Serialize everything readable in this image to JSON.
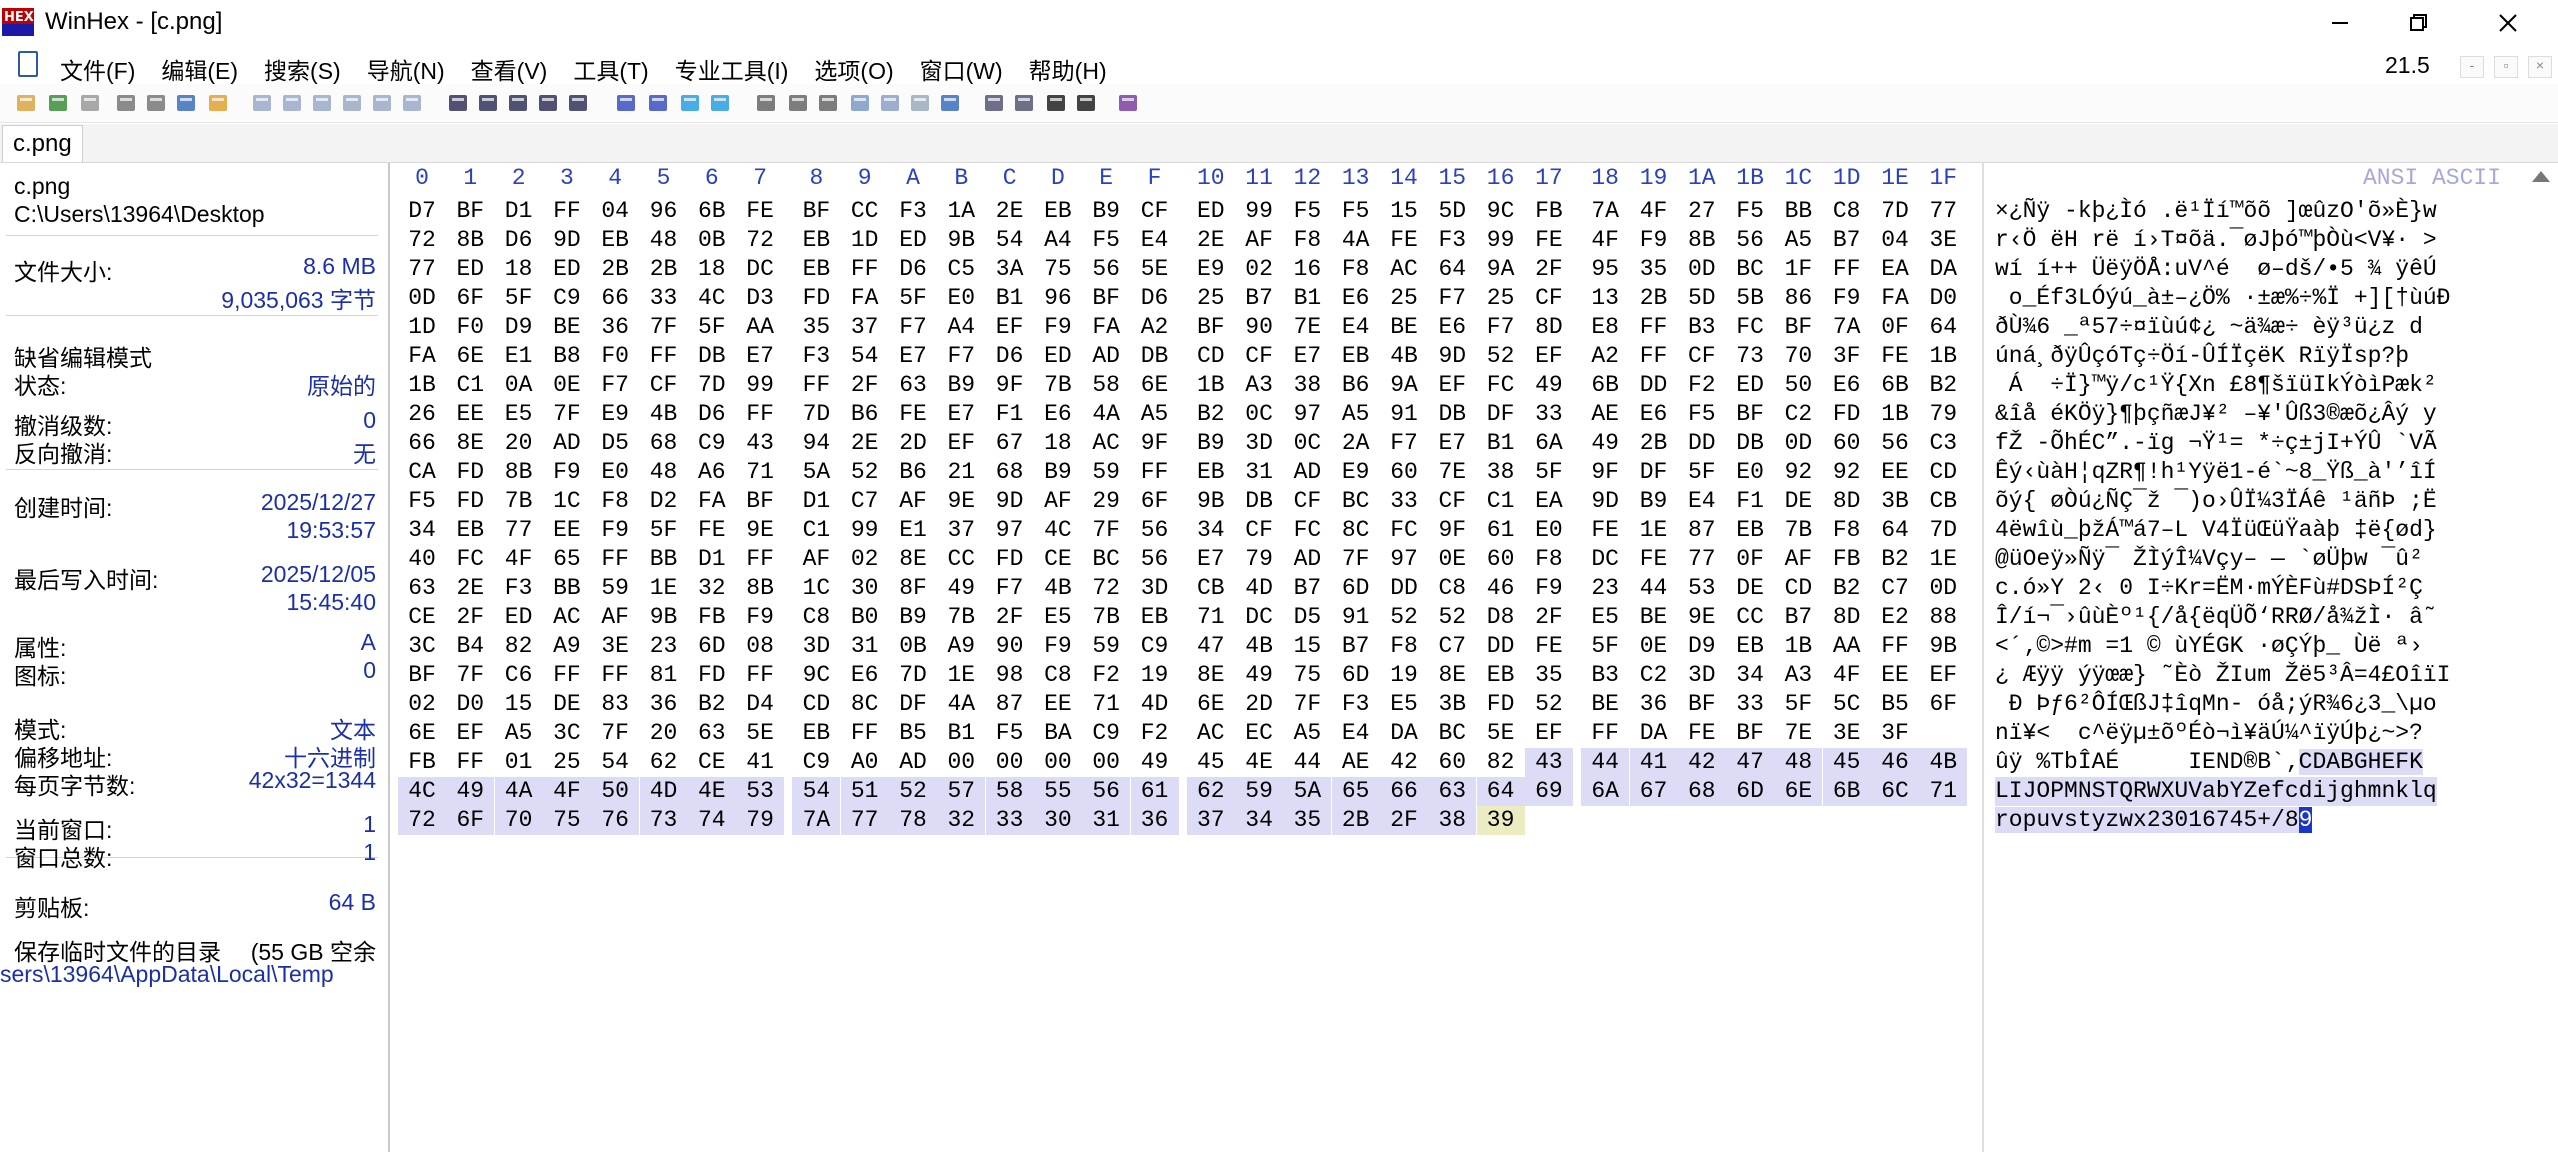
{
  "window": {
    "title": "WinHex - [c.png]",
    "logo_text": "HEX"
  },
  "menu": {
    "items": [
      "文件(F)",
      "编辑(E)",
      "搜索(S)",
      "导航(N)",
      "查看(V)",
      "工具(T)",
      "专业工具(I)",
      "选项(O)",
      "窗口(W)",
      "帮助(H)"
    ],
    "zoom": "21.5"
  },
  "toolbar": {
    "icons": [
      "new-file-icon",
      "open-file-icon",
      "save-icon",
      "print-icon",
      "printer-icon",
      "properties-icon",
      "open-folder-icon",
      "undo-icon",
      "copy-icon",
      "cut-icon",
      "paste-icon",
      "paste-write-icon",
      "paste-special-icon",
      "find-icon",
      "find-hex-icon",
      "find-text-icon",
      "replace-icon",
      "replace-hex-icon",
      "goto-offset-icon",
      "goto-end-icon",
      "back-arrow-icon",
      "forward-arrow-icon",
      "disk-icon",
      "open-disk-icon",
      "ram-icon",
      "calculator-icon",
      "magnifier-icon",
      "hashes-icon",
      "options-gear-icon",
      "position-icon",
      "columns-icon",
      "prev-icon",
      "next-icon",
      "help-book-icon"
    ]
  },
  "tab": {
    "label": "c.png"
  },
  "info": {
    "file_name": "c.png",
    "file_path": "C:\\Users\\13964\\Desktop",
    "size_label": "文件大小:",
    "size_mb": "8.6 MB",
    "size_bytes": "9,035,063 字节",
    "edit_mode_label": "缺省编辑模式",
    "state_label": "状态:",
    "state_value": "原始的",
    "undo_level_label": "撤消级数:",
    "undo_level_value": "0",
    "reverse_undo_label": "反向撤消:",
    "reverse_undo_value": "无",
    "created_label": "创建时间:",
    "created_date": "2025/12/27",
    "created_time": "19:53:57",
    "modified_label": "最后写入时间:",
    "modified_date": "2025/12/05",
    "modified_time": "15:45:40",
    "attr_label": "属性:",
    "attr_value": "A",
    "icon_label": "图标:",
    "icon_value": "0",
    "mode_label": "模式:",
    "mode_value": "文本",
    "offset_label": "偏移地址:",
    "offset_value": "十六进制",
    "bpp_label": "每页字节数:",
    "bpp_value": "42x32=1344",
    "curwin_label": "当前窗口:",
    "curwin_value": "1",
    "totwin_label": "窗口总数:",
    "totwin_value": "1",
    "clip_label": "剪贴板:",
    "clip_value": "64 B",
    "temp_label": "保存临时文件的目录",
    "temp_free": "(55 GB 空余",
    "temp_path": "sers\\13964\\AppData\\Local\\Temp"
  },
  "hex": {
    "header": [
      "0",
      "1",
      "2",
      "3",
      "4",
      "5",
      "6",
      "7",
      "8",
      "9",
      "A",
      "B",
      "C",
      "D",
      "E",
      "F",
      "10",
      "11",
      "12",
      "13",
      "14",
      "15",
      "16",
      "17",
      "18",
      "19",
      "1A",
      "1B",
      "1C",
      "1D",
      "1E",
      "1F"
    ],
    "rows": [
      "D7 BF D1 FF 04 96 6B FE BF CC F3 1A 2E EB B9 CF ED 99 F5 F5 15 5D 9C FB 7A 4F 27 F5 BB C8 7D 77",
      "72 8B D6 9D EB 48 0B 72 EB 1D ED 9B 54 A4 F5 E4 2E AF F8 4A FE F3 99 FE 4F F9 8B 56 A5 B7 04 3E",
      "77 ED 18 ED 2B 2B 18 DC EB FF D6 C5 3A 75 56 5E E9 02 16 F8 AC 64 9A 2F 95 35 0D BC 1F FF EA DA",
      "0D 6F 5F C9 66 33 4C D3 FD FA 5F E0 B1 96 BF D6 25 B7 B1 E6 25 F7 25 CF 13 2B 5D 5B 86 F9 FA D0",
      "1D F0 D9 BE 36 7F 5F AA 35 37 F7 A4 EF F9 FA A2 BF 90 7E E4 BE E6 F7 8D E8 FF B3 FC BF 7A 0F 64",
      "FA 6E E1 B8 F0 FF DB E7 F3 54 E7 F7 D6 ED AD DB CD CF E7 EB 4B 9D 52 EF A2 FF CF 73 70 3F FE 1B",
      "1B C1 0A 0E F7 CF 7D 99 FF 2F 63 B9 9F 7B 58 6E 1B A3 38 B6 9A EF FC 49 6B DD F2 ED 50 E6 6B B2",
      "26 EE E5 7F E9 4B D6 FF 7D B6 FE E7 F1 E6 4A A5 B2 0C 97 A5 91 DB DF 33 AE E6 F5 BF C2 FD 1B 79",
      "66 8E 20 AD D5 68 C9 43 94 2E 2D EF 67 18 AC 9F B9 3D 0C 2A F7 E7 B1 6A 49 2B DD DB 0D 60 56 C3",
      "CA FD 8B F9 E0 48 A6 71 5A 52 B6 21 68 B9 59 FF EB 31 AD E9 60 7E 38 5F 9F DF 5F E0 92 92 EE CD",
      "F5 FD 7B 1C F8 D2 FA BF D1 C7 AF 9E 9D AF 29 6F 9B DB CF BC 33 CF C1 EA 9D B9 E4 F1 DE 8D 3B CB",
      "34 EB 77 EE F9 5F FE 9E C1 99 E1 37 97 4C 7F 56 34 CF FC 8C FC 9F 61 E0 FE 1E 87 EB 7B F8 64 7D",
      "40 FC 4F 65 FF BB D1 FF AF 02 8E CC FD CE BC 56 E7 79 AD 7F 97 0E 60 F8 DC FE 77 0F AF FB B2 1E",
      "63 2E F3 BB 59 1E 32 8B 1C 30 8F 49 F7 4B 72 3D CB 4D B7 6D DD C8 46 F9 23 44 53 DE CD B2 C7 0D",
      "CE 2F ED AC AF 9B FB F9 C8 B0 B9 7B 2F E5 7B EB 71 DC D5 91 52 52 D8 2F E5 BE 9E CC B7 8D E2 88",
      "3C B4 82 A9 3E 23 6D 08 3D 31 0B A9 90 F9 59 C9 47 4B 15 B7 F8 C7 DD FE 5F 0E D9 EB 1B AA FF 9B",
      "BF 7F C6 FF FF 81 FD FF 9C E6 7D 1E 98 C8 F2 19 8E 49 75 6D 19 8E EB 35 B3 C2 3D 34 A3 4F EE EF",
      "02 D0 15 DE 83 36 B2 D4 CD 8C DF 4A 87 EE 71 4D 6E 2D 7F F3 E5 3B FD 52 BE 36 BF 33 5F 5C B5 6F",
      "6E EF A5 3C 7F 20 63 5E EB FF B5 B1 F5 BA C9 F2 AC EC A5 E4 DA BC 5E EF FF DA FE BF 7E 3E 3F",
      "FB FF 01 25 54 62 CE 41 C9 A0 AD 00 00 00 00 49 45 4E 44 AE 42 60 82 43 44 41 42 47 48 45 46 4B",
      "4C 49 4A 4F 50 4D 4E 53 54 51 52 57 58 55 56 61 62 59 5A 65 66 63 64 69 6A 67 68 6D 6E 6B 6C 71",
      "72 6F 70 75 76 73 74 79 7A 77 78 32 33 30 31 36 37 34 35 2B 2F 38 39"
    ]
  },
  "text": {
    "header": "ANSI ASCII",
    "rows": [
      "×¿Ñÿ -kþ¿Ìó .ë¹Ïí™õõ ]œûzO'õ»È}w",
      "r‹Ö ëH rë í›T¤õä.¯øJþó™þÒù<V¥· >",
      "wí í++ ÜëÿÖÅ:uV^é  ø–dš/•5 ¾ ÿêÚ",
      " o_Éf3LÓýú_à±–¿Ö% ·±æ%÷%Ï +][†ùúÐ",
      "ðÙ¾6 _ª57÷¤ïùú¢¿ ~ä¾æ÷ èÿ³ü¿z d",
      "úná¸ðÿÛçóTç÷Öí-ÛÍÏçëK RïÿÏsp?þ",
      " Á  ÷Ï}™ÿ/c¹Ÿ{Xn £8¶šïüIkÝòìPæk²",
      "&îå éKÖÿ}¶þçñæJ¥² –¥'Ûß3®æõ¿Âý y",
      "fŽ -ÕhÉC”.-ïg ¬Ÿ¹= *÷ç±jI+ÝÛ `VÃ",
      "Êý‹ùàH¦qZR¶!h¹Yÿë1-é`~8_Ÿß_à'’îÍ",
      "õý{ øÒú¿ÑÇ¯ž ¯)o›ÛÏ¼3ÏÁê ¹äñÞ ;Ë",
      "4ëwîù_þžÁ™á7–L V4ÏüŒüŸaàþ ‡ë{ød}",
      "@üOeÿ»Ñÿ¯ ŽÌýÎ¼Vçy– — `øÜþw ¯û²",
      "c.ó»Y 2‹ 0 I÷Kr=ËM·mÝÈFù#DSÞÍ²Ç",
      "Î/í¬¯›ûùÈº¹{/å{ëqÜÕ‘RRØ/å¾žÌ· â˜",
      "<´‚©>#m =1 © ùYÉGK ·øÇÝþ_ Ùë ª›",
      "¿ Æÿÿ ýÿœæ} ˜Èò ŽIum Žë5³Â=4£OîïI",
      " Ð Þƒ6²ÔÍŒßJ‡îqMn- óå;ýR¾6¿3_\\µo",
      "nï¥<  c^ëÿµ±õºÉò¬ì¥äÚ¼^ïÿÚþ¿~>?",
      "ûÿ %TbÎAÉ ­    IEND®B`‚",
      "LIJOPMNSTQRWXUVabYZefcdijghmnklq",
      "ropuvstyzwx23016745+/8"
    ],
    "row19_sel": "CDABGHEFK",
    "row21_cursor": "9"
  }
}
